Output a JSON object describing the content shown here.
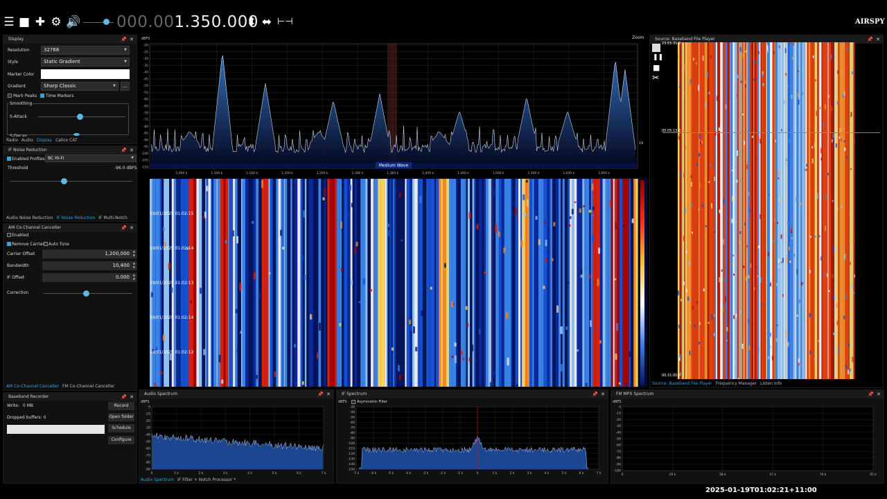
{
  "toolbar": {
    "freq_dim": "000.00",
    "freq_lit": "1.350.000",
    "logo": "AIRSPY"
  },
  "display_panel": {
    "title": "Display",
    "resolution_label": "Resolution",
    "resolution_value": "32768",
    "style_label": "Style",
    "style_value": "Static Gradient",
    "marker_color_label": "Marker Color",
    "gradient_label": "Gradient",
    "gradient_value": "Sharp Classic",
    "mark_peaks": "Mark Peaks",
    "time_markers": "Time Markers",
    "smoothing": "Smoothing",
    "s_attack": "S-Attack",
    "s_decay": "S-Decay",
    "tabs": [
      "Radio",
      "Audio",
      "Display",
      "Calico CAT"
    ]
  },
  "nr_panel": {
    "title": "IF Noise Reduction",
    "enabled": "Enabled",
    "profiles_label": "Profiles:",
    "profile_value": "BC Hi-Fi",
    "threshold_label": "Threshold",
    "threshold_value": "-96.0 dBFS",
    "tabs": [
      "Audio Noise Reduction",
      "IF Noise Reduction",
      "IF Multi-Notch"
    ]
  },
  "cc_panel": {
    "title": "AM Co-Channel Canceller",
    "enabled": "Enabled",
    "remove_carrier": "Remove Carrier",
    "auto_tune": "Auto Tune",
    "carrier_offset_label": "Carrier Offset",
    "carrier_offset_value": "1,200,000",
    "bandwidth_label": "Bandwidth",
    "bandwidth_value": "10,400",
    "if_offset_label": "IF Offset",
    "if_offset_value": "0.000",
    "correction_label": "Correction",
    "tabs": [
      "AM Co-Channel Canceller",
      "FM Co-Channel Canceller"
    ]
  },
  "recorder": {
    "title": "Baseband Recorder",
    "write": "Write:",
    "write_value": "0 MB",
    "dropped": "Dropped buffers: 0",
    "record": "Record",
    "open_folder": "Open folder",
    "schedule": "Schedule",
    "configure": "Configure"
  },
  "spectrum": {
    "unit": "dBFS",
    "y_ticks": [
      "-20",
      "-25",
      "-30",
      "-35",
      "-40",
      "-45",
      "-50",
      "-55",
      "-60",
      "-65",
      "-70",
      "-75",
      "-80",
      "-85",
      "-90",
      "-95",
      "-100",
      "-105",
      "-110"
    ],
    "x_ticks": [
      "1,060 k",
      "1,100 k",
      "1,160 k",
      "1,200 k",
      "1,260 k",
      "1,300 k",
      "1,360 k",
      "1,400 k",
      "1,460 k",
      "1,500 k",
      "1,560 k",
      "1,600 k",
      "1,660 k"
    ],
    "band_label": "Medium Wave",
    "zoom": "Zoom",
    "right_value": "19"
  },
  "waterfall": {
    "timestamps": [
      "19/01/2025 01:02:15",
      "19/01/2025 01:02:14",
      "19/01/2025 01:02:13",
      "19/01/2025 01:02:14",
      "19/01/2025 01:02:12"
    ]
  },
  "player": {
    "title": "Source: Baseband File Player",
    "time_top": "23:55:31.0",
    "time_mid": "00:05:13.0",
    "time_bottom": "00:31:00.0",
    "tabs": [
      "Source: Baseband File Player",
      "Frequency Manager",
      "Listen Info"
    ]
  },
  "audio_spec": {
    "title": "Audio Spectrum",
    "unit": "dBFS",
    "y_ticks": [
      "0",
      "-10",
      "-20",
      "-30",
      "-40",
      "-50",
      "-60",
      "-70",
      "-80",
      "-90"
    ],
    "x_ticks": [
      "0",
      "1 k",
      "2 k",
      "3 k",
      "4 k",
      "5 k",
      "6 k",
      "7 k"
    ],
    "tabs": [
      "Audio Spectrum",
      "IF Filter + Notch Processor *"
    ]
  },
  "if_spec": {
    "title": "IF Spectrum",
    "unit": "dBFS",
    "asym": "Asymmetric Filter",
    "y_ticks": [
      "-30",
      "-40",
      "-50",
      "-60",
      "-70",
      "-80",
      "-90",
      "-100",
      "-110",
      "-120",
      "-130",
      "-140",
      "-150"
    ],
    "x_ticks": [
      "-7 k",
      "-6 k",
      "-5 k",
      "-4 k",
      "-3 k",
      "-2 k",
      "-1 k",
      "0",
      "1 k",
      "2 k",
      "3 k",
      "4 k",
      "5 k",
      "6 k",
      "7 k"
    ]
  },
  "mpx_spec": {
    "title": "FM MPX Spectrum",
    "unit": "dBFS",
    "y_ticks": [
      "0",
      "-10",
      "-20",
      "-30",
      "-40",
      "-50",
      "-60",
      "-70",
      "-80",
      "-90",
      "-100"
    ],
    "x_ticks": [
      "0",
      "19 k",
      "38 k",
      "57 k",
      "76 k",
      "95 k"
    ]
  },
  "clock": "2025-01-19T01:02:21+11:00"
}
